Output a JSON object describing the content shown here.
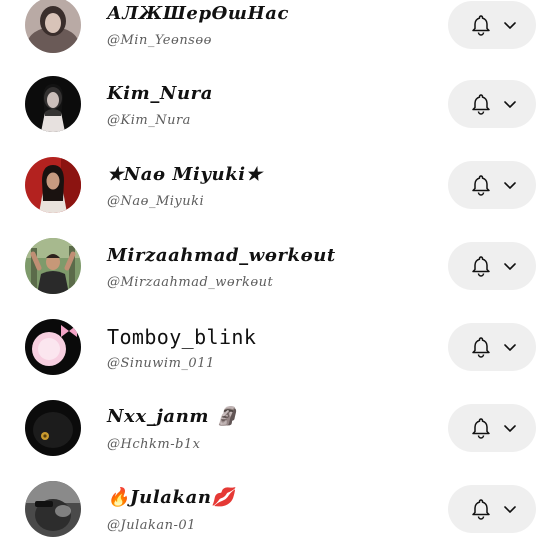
{
  "subscriptions": [
    {
      "name": "АЛЖШерӨшНас",
      "handle": "@Min_Yeɵnsɵɵ",
      "avatar": "dark-portrait"
    },
    {
      "name": "Kim_Nura",
      "handle": "@Kim_Nura",
      "avatar": "dark-portrait-2"
    },
    {
      "name": "★Naɵ Miyuki★",
      "handle": "@Naɵ_Miyuki",
      "avatar": "red-portrait"
    },
    {
      "name": "Mirzaahmad_wɵrkɵut",
      "handle": "@Mirzaahmad_wɵrkɵut",
      "avatar": "gym-photo"
    },
    {
      "name": "Tomboy_blink",
      "handle": "@Sinuwim_011",
      "avatar": "pink-circle"
    },
    {
      "name": "Nxx_janm 🗿",
      "handle": "@Hchkm-b1x",
      "avatar": "dark-gold"
    },
    {
      "name": "🔥Julakan💋",
      "handle": "@Julakan-01",
      "avatar": "gray-blur"
    }
  ],
  "icons": {
    "notify": "bell-icon",
    "expand": "chevron-down-icon"
  },
  "colors": {
    "text": "#111111",
    "subtext": "#5d5d5d",
    "button_bg": "#efefef"
  }
}
